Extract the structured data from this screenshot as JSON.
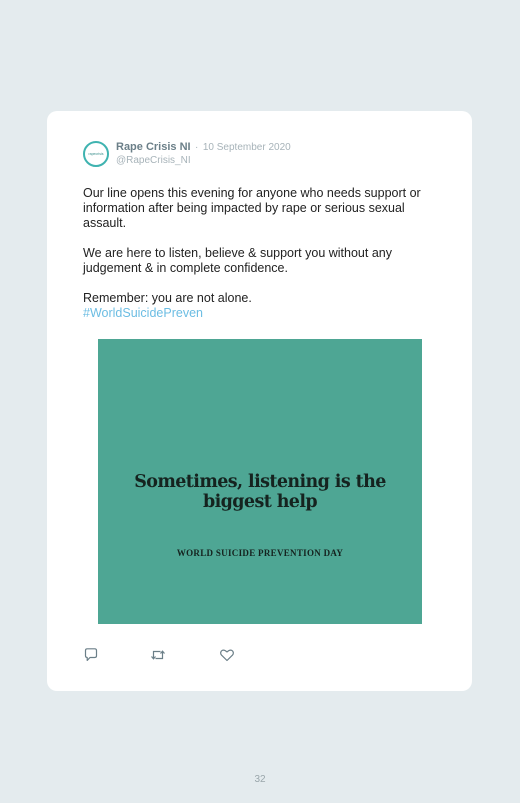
{
  "tweet": {
    "avatar_text": "rapecrisis",
    "author_name": "Rape Crisis NI",
    "separator": "·",
    "date": "10 September 2020",
    "handle": "@RapeCrisis_NI",
    "paragraphs": [
      "Our line opens this evening for anyone who needs support or information after being impacted by rape or serious sexual assault.",
      "We are here to listen, believe & support you without any judgement & in complete confidence.",
      "Remember: you are not alone."
    ],
    "hashtag": "#WorldSuicidePreven",
    "media": {
      "background_color": "#4ea694",
      "title": "Sometimes, listening is the biggest help",
      "subtitle": "WORLD SUICIDE PREVENTION DAY"
    },
    "actions": {
      "reply_icon": "reply-icon",
      "retweet_icon": "retweet-icon",
      "like_icon": "heart-icon"
    }
  },
  "colors": {
    "page_background": "#e4ebee",
    "card_background": "#ffffff",
    "hashtag": "#6cbde3",
    "avatar_ring": "#3fb3b0"
  },
  "page_number": "32"
}
